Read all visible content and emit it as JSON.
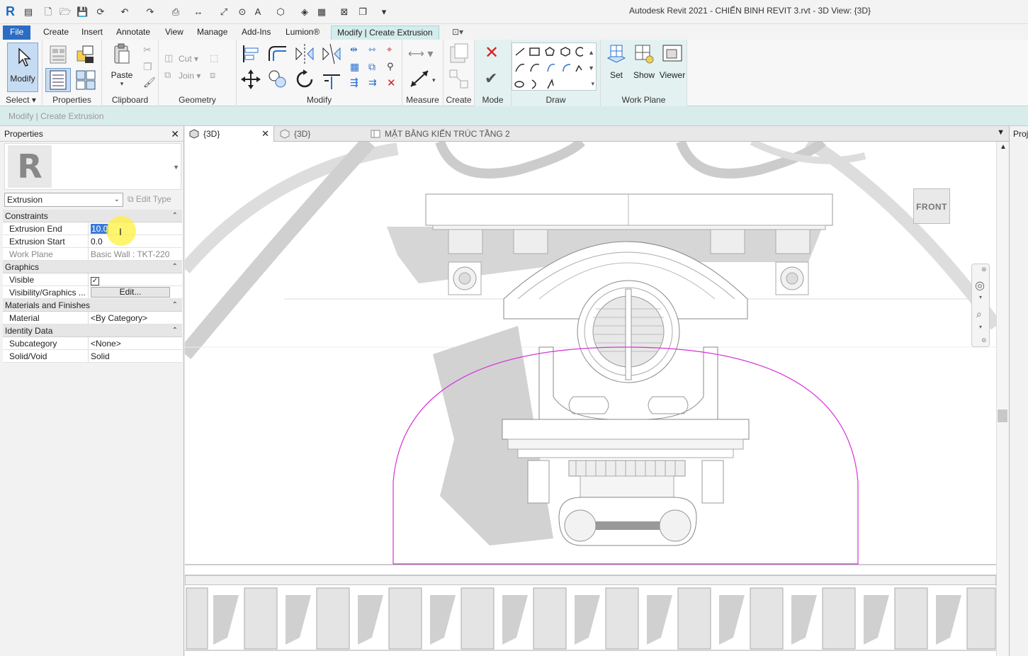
{
  "app": {
    "title": "Autodesk Revit 2021 - CHIẾN BINH REVIT 3.rvt - 3D View: {3D}"
  },
  "ribbon_tabs": [
    {
      "label": "File"
    },
    {
      "label": "Create"
    },
    {
      "label": "Insert"
    },
    {
      "label": "Annotate"
    },
    {
      "label": "View"
    },
    {
      "label": "Manage"
    },
    {
      "label": "Add-Ins"
    },
    {
      "label": "Lumion®"
    },
    {
      "label": "Modify | Create Extrusion"
    }
  ],
  "ribbon": {
    "select": {
      "button": "Modify",
      "panel": "Select"
    },
    "properties": {
      "panel": "Properties"
    },
    "clipboard": {
      "button": "Paste",
      "panel": "Clipboard"
    },
    "geometry": {
      "cut": "Cut",
      "join": "Join",
      "panel": "Geometry"
    },
    "modify": {
      "panel": "Modify"
    },
    "measure": {
      "panel": "Measure"
    },
    "create": {
      "panel": "Create"
    },
    "mode": {
      "panel": "Mode"
    },
    "draw": {
      "panel": "Draw"
    },
    "workplane": {
      "set": "Set",
      "show": "Show",
      "viewer": "Viewer",
      "panel": "Work Plane"
    }
  },
  "options_bar": {
    "label": "Modify | Create Extrusion"
  },
  "properties": {
    "title": "Properties",
    "type_selector": "Extrusion",
    "edit_type": "Edit Type",
    "groups": [
      {
        "name": "Constraints",
        "rows": [
          {
            "key": "Extrusion End",
            "value": "10.0"
          },
          {
            "key": "Extrusion Start",
            "value": "0.0"
          },
          {
            "key": "Work Plane",
            "value": "Basic Wall : TKT-220"
          }
        ]
      },
      {
        "name": "Graphics",
        "rows": [
          {
            "key": "Visible",
            "value": "checked"
          },
          {
            "key": "Visibility/Graphics ...",
            "value": "Edit..."
          }
        ]
      },
      {
        "name": "Materials and Finishes",
        "rows": [
          {
            "key": "Material",
            "value": "<By Category>"
          }
        ]
      },
      {
        "name": "Identity Data",
        "rows": [
          {
            "key": "Subcategory",
            "value": "<None>"
          },
          {
            "key": "Solid/Void",
            "value": "Solid"
          }
        ]
      }
    ]
  },
  "view_tabs": [
    {
      "label": "{3D}",
      "active": true
    },
    {
      "label": "{3D}",
      "active": false
    },
    {
      "label": "MẶT BẰNG KIẾN TRÚC TẦNG 2",
      "active": false
    }
  ],
  "viewcube": {
    "face": "FRONT"
  },
  "project_browser": {
    "label": "Proj"
  },
  "colors": {
    "accent": "#2b6cc4",
    "sketch_line": "#d633d6",
    "context_tab": "#d5ecec"
  }
}
